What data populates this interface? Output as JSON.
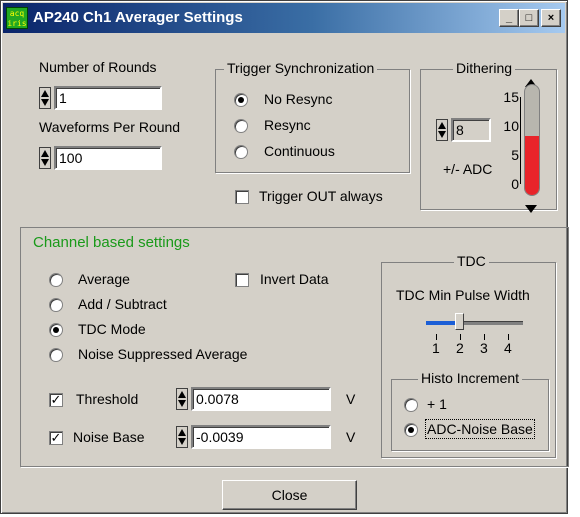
{
  "window": {
    "title": "AP240 Ch1 Averager Settings",
    "app_icon_text": "acqiris",
    "controls": {
      "minimize": "_",
      "maximize": "□",
      "close": "×"
    }
  },
  "rounds": {
    "rounds_label": "Number of Rounds",
    "rounds_value": "1",
    "waveforms_label": "Waveforms Per Round",
    "waveforms_value": "100"
  },
  "trigger_sync": {
    "title": "Trigger Synchronization",
    "options": [
      "No Resync",
      "Resync",
      "Continuous"
    ],
    "selected": "No Resync"
  },
  "trigger_out": {
    "label": "Trigger OUT always",
    "checked": false
  },
  "dithering": {
    "title": "Dithering",
    "value": "8",
    "unit_label": "+/- ADC",
    "scale_ticks": [
      "15",
      "10",
      "5",
      "0"
    ],
    "level": 8,
    "max": 15
  },
  "channel": {
    "title": "Channel based settings",
    "modes": [
      "Average",
      "Add / Subtract",
      "TDC Mode",
      "Noise Suppressed Average"
    ],
    "selected_mode": "TDC Mode",
    "invert_label": "Invert Data",
    "invert_checked": false,
    "threshold_label": "Threshold",
    "threshold_checked": true,
    "threshold_value": "0.0078",
    "threshold_unit": "V",
    "noise_label": "Noise Base",
    "noise_checked": true,
    "noise_value": "-0.0039",
    "noise_unit": "V"
  },
  "tdc": {
    "title": "TDC",
    "pulse_label": "TDC Min Pulse Width",
    "slider_ticks": [
      "1",
      "2",
      "3",
      "4"
    ],
    "slider_value": 2,
    "histo_title": "Histo Increment",
    "histo_options": [
      "+ 1",
      "ADC-Noise Base"
    ],
    "histo_selected": "ADC-Noise Base"
  },
  "footer": {
    "close_label": "Close"
  },
  "colors": {
    "face": "#d4d0c8",
    "title_start": "#0a246a",
    "title_end": "#a6caf0",
    "group_title": "#1a9a1a",
    "thermo_fill": "#e8242a"
  }
}
